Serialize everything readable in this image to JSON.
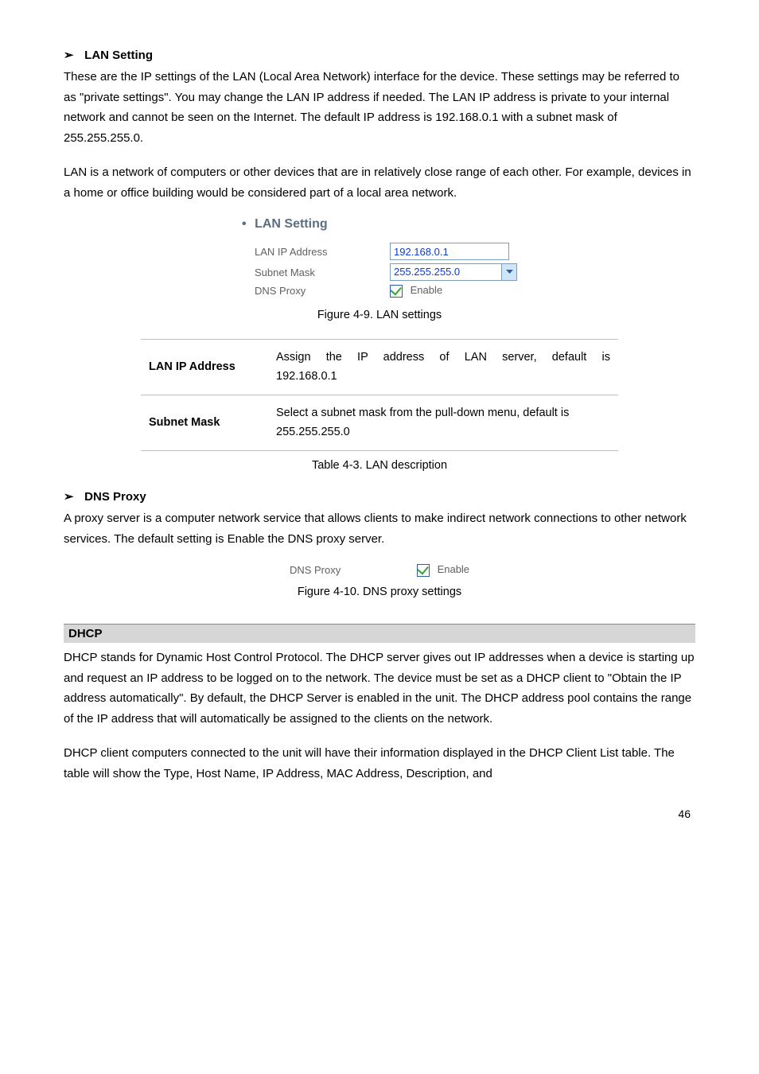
{
  "section1": {
    "title": "LAN Setting",
    "bullet": "➢",
    "para1": "These are the IP settings of the LAN (Local Area Network) interface for the device. These settings may be referred to as \"private settings\". You may change the LAN IP address if needed. The LAN IP address is private to your internal network and cannot be seen on the Internet. The default IP address is 192.168.0.1 with a subnet mask of 255.255.255.0.",
    "para2": "LAN is a network of computers or other devices that are in relatively close range of each other. For example, devices in a home or office building would be considered part of a local area network."
  },
  "lanfig": {
    "title": "LAN Setting",
    "rows": {
      "ip_label": "LAN IP Address",
      "ip_value": "192.168.0.1",
      "mask_label": "Subnet Mask",
      "mask_value": "255.255.255.0",
      "dns_label": "DNS Proxy",
      "dns_checkbox": "Enable"
    },
    "caption": "Figure 4-9. LAN settings"
  },
  "desc_table": {
    "rows": [
      {
        "key": "LAN IP Address",
        "line1": "Assign the IP address of LAN server, default is",
        "line2": "192.168.0.1"
      },
      {
        "key": "Subnet Mask",
        "line1": "Select a subnet mask from the pull-down menu, default is",
        "line2": "255.255.255.0"
      }
    ],
    "caption": "Table 4-3. LAN description"
  },
  "section2": {
    "title": "DNS Proxy",
    "bullet": "➢",
    "para": "A proxy server is a computer network service that allows clients to make indirect network connections to other network services. The default setting is Enable the DNS proxy server."
  },
  "dnsfig": {
    "label": "DNS Proxy",
    "checkbox": "Enable",
    "caption": "Figure 4-10. DNS proxy settings"
  },
  "dhcp": {
    "title": "DHCP",
    "para1": "DHCP stands for Dynamic Host Control Protocol. The DHCP server gives out IP addresses when a device is starting up and request an IP address to be logged on to the network. The device must be set as a DHCP client to \"Obtain the IP address automatically\". By default, the DHCP Server is enabled in the unit. The DHCP address pool contains the range of the IP address that will automatically be assigned to the clients on the network.",
    "para2": "DHCP client computers connected to the unit will have their information displayed in the DHCP Client List table. The table will show the Type, Host Name, IP Address, MAC Address, Description, and"
  },
  "page_number": "46"
}
